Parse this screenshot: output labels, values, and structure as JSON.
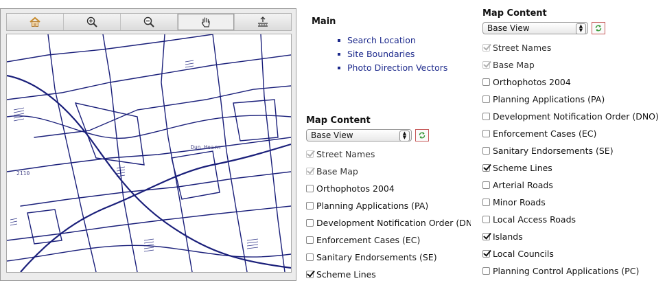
{
  "map_toolbar": {
    "tools": [
      {
        "name": "home",
        "icon": "home-icon"
      },
      {
        "name": "zoom-in",
        "icon": "zoom-in-icon"
      },
      {
        "name": "zoom-out",
        "icon": "zoom-out-icon"
      },
      {
        "name": "pan",
        "icon": "pan-hand-icon",
        "active": true
      },
      {
        "name": "full-extent",
        "icon": "full-extent-icon"
      }
    ]
  },
  "map": {
    "labels": [
      "Dun Hearn",
      "2110"
    ],
    "line_color": "#1a1f7a"
  },
  "main_menu": {
    "title": "Main",
    "links": [
      "Search Location",
      "Site Boundaries",
      "Photo Direction Vectors"
    ]
  },
  "map_content_left": {
    "title": "Map Content",
    "view_select": "Base View",
    "layers": [
      {
        "label": "Street Names",
        "checked": true,
        "disabled": true
      },
      {
        "label": "Base Map",
        "checked": true,
        "disabled": true
      },
      {
        "label": "Orthophotos 2004",
        "checked": false,
        "disabled": false
      },
      {
        "label": "Planning Applications (PA)",
        "checked": false,
        "disabled": false
      },
      {
        "label": "Development Notification Order (DNO",
        "checked": false,
        "disabled": false
      },
      {
        "label": "Enforcement Cases (EC)",
        "checked": false,
        "disabled": false
      },
      {
        "label": "Sanitary Endorsements (SE)",
        "checked": false,
        "disabled": false
      },
      {
        "label": "Scheme Lines",
        "checked": true,
        "disabled": false
      }
    ]
  },
  "map_content_right": {
    "title": "Map Content",
    "view_select": "Base View",
    "layers": [
      {
        "label": "Street Names",
        "checked": true,
        "disabled": true
      },
      {
        "label": "Base Map",
        "checked": true,
        "disabled": true
      },
      {
        "label": "Orthophotos 2004",
        "checked": false,
        "disabled": false
      },
      {
        "label": "Planning Applications (PA)",
        "checked": false,
        "disabled": false
      },
      {
        "label": "Development Notification Order (DNO)",
        "checked": false,
        "disabled": false
      },
      {
        "label": "Enforcement Cases (EC)",
        "checked": false,
        "disabled": false
      },
      {
        "label": "Sanitary Endorsements (SE)",
        "checked": false,
        "disabled": false
      },
      {
        "label": "Scheme Lines",
        "checked": true,
        "disabled": false
      },
      {
        "label": "Arterial Roads",
        "checked": false,
        "disabled": false
      },
      {
        "label": "Minor Roads",
        "checked": false,
        "disabled": false
      },
      {
        "label": "Local Access Roads",
        "checked": false,
        "disabled": false
      },
      {
        "label": "Islands",
        "checked": true,
        "disabled": false
      },
      {
        "label": "Local Councils",
        "checked": true,
        "disabled": false
      },
      {
        "label": "Planning Control Applications (PC)",
        "checked": false,
        "disabled": false
      }
    ]
  },
  "colors": {
    "link": "#1d2a8c",
    "refresh_border": "#c65b5b",
    "refresh_arrows": "#3a9a3a"
  }
}
